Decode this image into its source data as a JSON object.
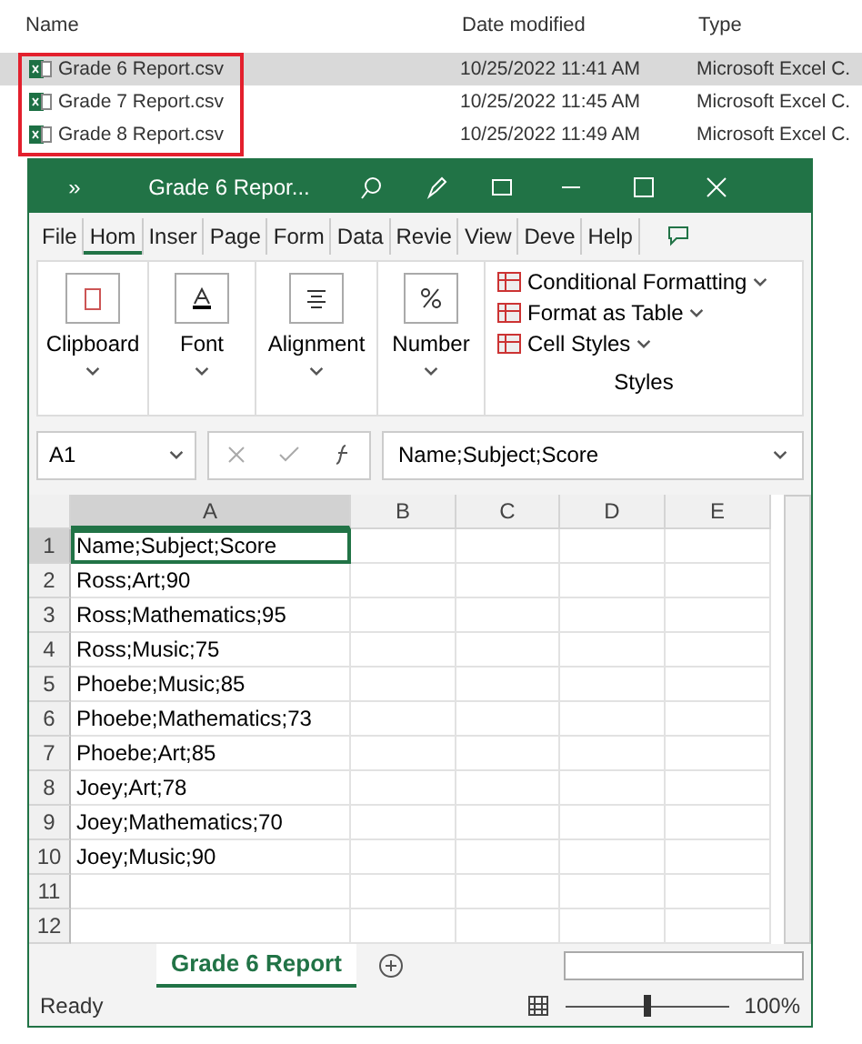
{
  "explorer": {
    "columns": [
      "Name",
      "Date modified",
      "Type"
    ],
    "files": [
      {
        "name": "Grade 6 Report.csv",
        "date": "10/25/2022 11:41 AM",
        "type": "Microsoft Excel C.",
        "selected": true
      },
      {
        "name": "Grade 7 Report.csv",
        "date": "10/25/2022 11:45 AM",
        "type": "Microsoft Excel C.",
        "selected": false
      },
      {
        "name": "Grade 8 Report.csv",
        "date": "10/25/2022 11:49 AM",
        "type": "Microsoft Excel C.",
        "selected": false
      }
    ]
  },
  "window": {
    "more": "»",
    "title": "Grade 6 Repor..."
  },
  "tabs": [
    {
      "label": "File",
      "selected": false
    },
    {
      "label": "Hom",
      "selected": true
    },
    {
      "label": "Inser",
      "selected": false
    },
    {
      "label": "Page",
      "selected": false
    },
    {
      "label": "Form",
      "selected": false
    },
    {
      "label": "Data",
      "selected": false
    },
    {
      "label": "Revie",
      "selected": false
    },
    {
      "label": "View",
      "selected": false
    },
    {
      "label": "Deve",
      "selected": false
    },
    {
      "label": "Help",
      "selected": false
    }
  ],
  "ribbon": {
    "groups": [
      {
        "label": "Clipboard",
        "kind": "clipboard"
      },
      {
        "label": "Font",
        "kind": "font"
      },
      {
        "label": "Alignment",
        "kind": "align"
      },
      {
        "label": "Number",
        "kind": "number"
      }
    ],
    "styles": {
      "items": [
        "Conditional Formatting",
        "Format as Table",
        "Cell Styles"
      ],
      "label": "Styles"
    }
  },
  "formula_bar": {
    "name_box": "A1",
    "value": "Name;Subject;Score"
  },
  "sheet": {
    "columns": [
      "A",
      "B",
      "C",
      "D",
      "E"
    ],
    "rows": [
      {
        "number": "1",
        "value": "Name;Subject;Score",
        "selected": true
      },
      {
        "number": "2",
        "value": "Ross;Art;90",
        "selected": false
      },
      {
        "number": "3",
        "value": "Ross;Mathematics;95",
        "selected": false
      },
      {
        "number": "4",
        "value": "Ross;Music;75",
        "selected": false
      },
      {
        "number": "5",
        "value": "Phoebe;Music;85",
        "selected": false
      },
      {
        "number": "6",
        "value": "Phoebe;Mathematics;73",
        "selected": false
      },
      {
        "number": "7",
        "value": "Phoebe;Art;85",
        "selected": false
      },
      {
        "number": "8",
        "value": "Joey;Art;78",
        "selected": false
      },
      {
        "number": "9",
        "value": "Joey;Mathematics;70",
        "selected": false
      },
      {
        "number": "10",
        "value": "Joey;Music;90",
        "selected": false
      },
      {
        "number": "11",
        "selected": false
      },
      {
        "number": "12",
        "selected": false
      }
    ]
  },
  "sheet_tabs": [
    {
      "label": "Grade 6 Report",
      "selected": true
    }
  ],
  "status_bar": {
    "status": "Ready",
    "zoom_slider": {
      "level": 0.5
    },
    "zoom": "100%"
  }
}
